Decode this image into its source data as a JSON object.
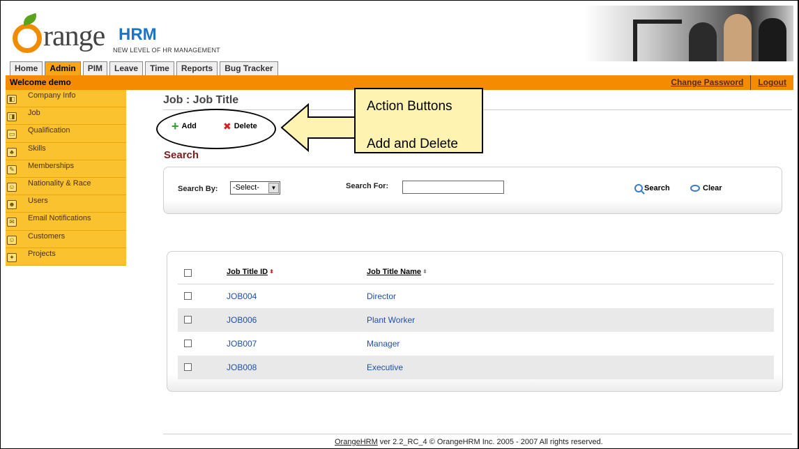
{
  "header": {
    "logo_name": "OrangeHRM",
    "logo_word": "range",
    "logo_hrm": "HRM",
    "tagline": "NEW LEVEL OF HR MANAGEMENT"
  },
  "tabs": [
    {
      "label": "Home"
    },
    {
      "label": "Admin"
    },
    {
      "label": "PIM"
    },
    {
      "label": "Leave"
    },
    {
      "label": "Time"
    },
    {
      "label": "Reports"
    },
    {
      "label": "Bug Tracker"
    }
  ],
  "active_tab": "Admin",
  "topbar": {
    "welcome": "Welcome demo",
    "change_password": "Change Password",
    "logout": "Logout"
  },
  "sidebar": {
    "items": [
      {
        "label": "Company Info",
        "icon": "company-icon"
      },
      {
        "label": "Job",
        "icon": "job-icon"
      },
      {
        "label": "Qualification",
        "icon": "qualification-icon"
      },
      {
        "label": "Skills",
        "icon": "skills-icon"
      },
      {
        "label": "Memberships",
        "icon": "memberships-icon"
      },
      {
        "label": "Nationality & Race",
        "icon": "nationality-icon"
      },
      {
        "label": "Users",
        "icon": "users-icon"
      },
      {
        "label": "Email Notifications",
        "icon": "email-icon"
      },
      {
        "label": "Customers",
        "icon": "customers-icon"
      },
      {
        "label": "Projects",
        "icon": "projects-icon"
      }
    ]
  },
  "main": {
    "title": "Job : Job Title",
    "add_label": "Add",
    "delete_label": "Delete",
    "search_heading": "Search"
  },
  "callout": {
    "line1": "Action Buttons",
    "line2": "Add and Delete"
  },
  "search": {
    "search_by_label": "Search By:",
    "search_by_value": "-Select-",
    "search_for_label": "Search For:",
    "search_for_value": "",
    "search_button": "Search",
    "clear_button": "Clear"
  },
  "table": {
    "columns": [
      "Job Title ID",
      "Job Title Name"
    ],
    "rows": [
      {
        "id": "JOB004",
        "name": "Director"
      },
      {
        "id": "JOB006",
        "name": "Plant Worker"
      },
      {
        "id": "JOB007",
        "name": "Manager"
      },
      {
        "id": "JOB008",
        "name": "Executive"
      }
    ]
  },
  "footer": {
    "link": "OrangeHRM",
    "text": " ver 2.2_RC_4 © OrangeHRM Inc. 2005 - 2007 All rights reserved."
  },
  "colors": {
    "orange_bar": "#f58b00",
    "sidebar": "#f9c22e",
    "callout_fill": "#fef3b0",
    "link_blue": "#1f4fa8",
    "search_heading": "#7a1d1d"
  }
}
